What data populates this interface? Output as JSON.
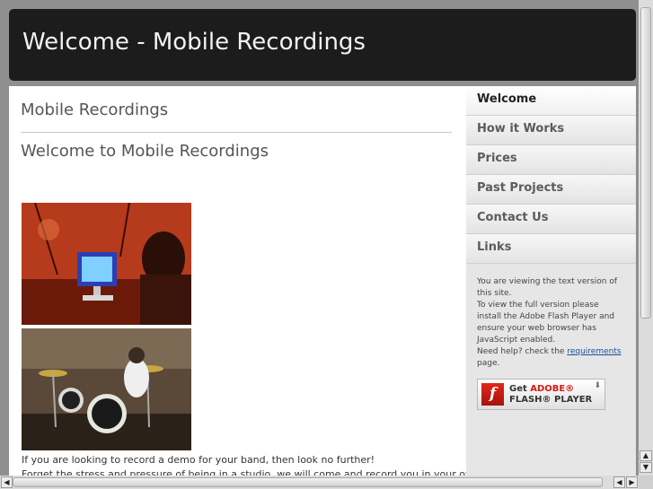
{
  "header": {
    "title": "Welcome - Mobile Recordings"
  },
  "content": {
    "site_title": "Mobile Recordings",
    "page_heading": "Welcome to Mobile Recordings",
    "body_lines": [
      "If you are looking to record a demo for your band, then look no further!",
      "Forget the stress and pressure of being in a studio, we will come and record you in your own"
    ]
  },
  "sidebar": {
    "nav": [
      {
        "label": "Welcome",
        "active": true
      },
      {
        "label": "How it Works",
        "active": false
      },
      {
        "label": "Prices",
        "active": false
      },
      {
        "label": "Past Projects",
        "active": false
      },
      {
        "label": "Contact Us",
        "active": false
      },
      {
        "label": "Links",
        "active": false
      }
    ],
    "notice": {
      "line1": "You are viewing the text version of this site.",
      "line2": "To view the full version please install the Adobe Flash Player and ensure your web browser has JavaScript enabled.",
      "line3_pre": "Need help? check the",
      "link": "requirements",
      "line3_post": "page."
    },
    "flash_badge": {
      "logo_glyph": "f",
      "get": "Get",
      "brand": "ADOBE®",
      "product": "FLASH® PLAYER"
    }
  },
  "colors": {
    "header_bg": "#1c1c1c",
    "page_bg": "#8f8f8f",
    "sidebar_bg": "#e6e6e6",
    "flash_red": "#d11c12",
    "link": "#1a4f9c"
  }
}
